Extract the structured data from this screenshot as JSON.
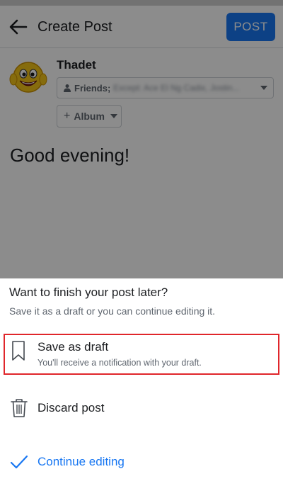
{
  "header": {
    "title": "Create Post",
    "post_label": "POST"
  },
  "composer": {
    "user_name": "Thadet",
    "privacy_label": "Friends;",
    "privacy_detail": "Except: Ace El Ng Cadix, Jostin...",
    "album_label": "Album",
    "post_text": "Good evening!"
  },
  "sheet": {
    "title": "Want to finish your post later?",
    "subtitle": "Save it as a draft or you can continue editing it.",
    "save_draft": {
      "label": "Save as draft",
      "description": "You'll receive a notification with your draft."
    },
    "discard_label": "Discard post",
    "continue_label": "Continue editing"
  },
  "colors": {
    "accent": "#1877f2",
    "highlight_border": "#e0262b"
  },
  "icons": {
    "back": "arrow-left-icon",
    "privacy": "person-icon",
    "draft": "bookmark-icon",
    "discard": "trash-icon",
    "continue": "check-icon"
  }
}
